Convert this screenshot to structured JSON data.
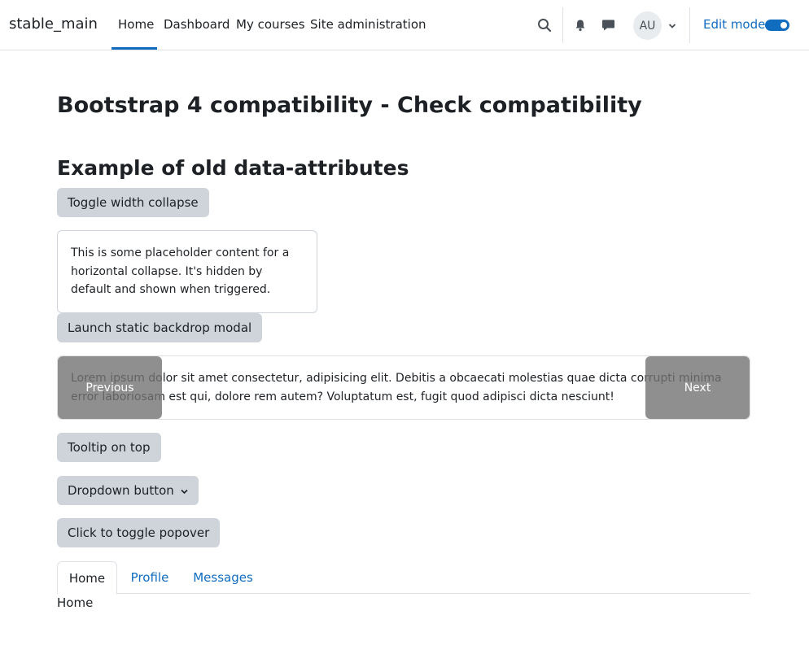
{
  "navbar": {
    "brand": "stable_main",
    "links": [
      "Home",
      "Dashboard",
      "My courses",
      "Site administration"
    ],
    "avatar_initials": "AU",
    "edit_mode_label": "Edit mode",
    "edit_mode_on": true,
    "icons": [
      "search-icon",
      "bell-icon",
      "chat-icon",
      "chevron-down-icon"
    ]
  },
  "page": {
    "title": "Bootstrap 4 compatibility - Check compatibility",
    "section_title": "Example of old data-attributes",
    "toggle_collapse_label": "Toggle width collapse",
    "collapse_text": "This is some placeholder content for a horizontal collapse. It's hidden by default and shown when triggered.",
    "modal_button_label": "Launch static backdrop modal",
    "carousel_text": "Lorem ipsum dolor sit amet consectetur, adipisicing elit. Debitis a obcaecati molestias quae dicta corrupti minima error laboriosam est qui, dolore rem autem? Voluptatum est, fugit quod adipisci dicta nesciunt!",
    "carousel_prev": "Previous",
    "carousel_next": "Next",
    "tooltip_button_label": "Tooltip on top",
    "dropdown_button_label": "Dropdown button",
    "popover_button_label": "Click to toggle popover",
    "tabs": [
      "Home",
      "Profile",
      "Messages"
    ],
    "tab_content": "Home"
  },
  "colors": {
    "primary": "#0f6cbf",
    "button_bg": "#ced4da",
    "text": "#1d2125"
  }
}
